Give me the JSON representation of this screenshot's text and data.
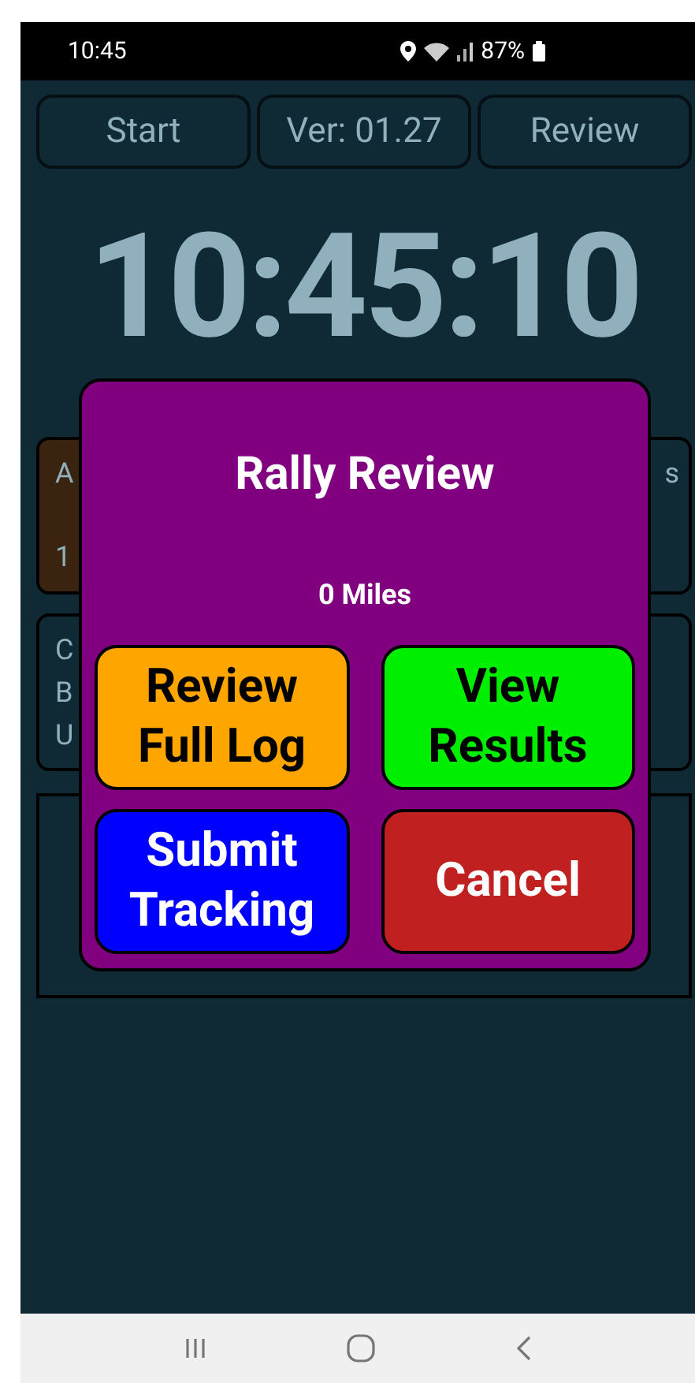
{
  "status_bar": {
    "time": "10:45",
    "battery": "87%"
  },
  "top_buttons": [
    {
      "label": "Start"
    },
    {
      "label": "Ver: 01.27"
    },
    {
      "label": "Review"
    }
  ],
  "clock": "10:45:10",
  "background_cards": [
    {
      "texts": [
        "A",
        "1"
      ],
      "color": "#3a2410"
    },
    {
      "texts": [
        "s"
      ],
      "color": "#0f2a35"
    },
    {
      "texts": [
        "C",
        "B",
        "U"
      ],
      "color": "#0f2a35"
    },
    {
      "color": "#0f2a35"
    }
  ],
  "dialog": {
    "title": "Rally Review",
    "subtitle": "0 Miles",
    "buttons": [
      {
        "lines": [
          "Review",
          "Full Log"
        ],
        "color": "#ffa500"
      },
      {
        "lines": [
          "View",
          "Results"
        ],
        "color": "#00ee00"
      },
      {
        "lines": [
          "Submit",
          "Tracking"
        ],
        "color": "#0000ff"
      },
      {
        "lines": [
          "Cancel"
        ],
        "color": "#c02020"
      }
    ]
  }
}
